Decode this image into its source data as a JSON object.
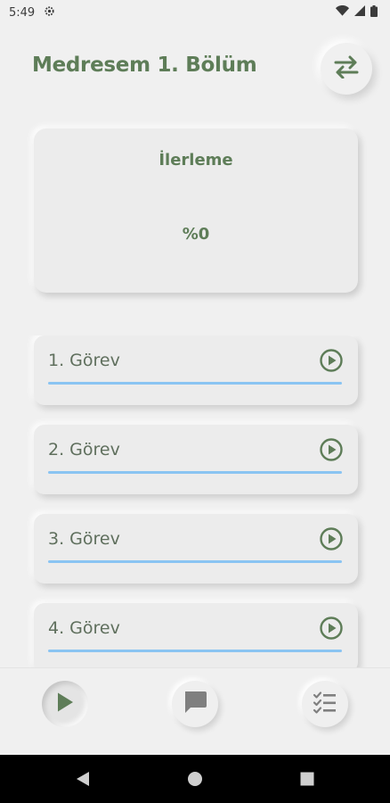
{
  "status_bar": {
    "time": "5:49"
  },
  "header": {
    "title": "Medresem 1. Bölüm"
  },
  "progress": {
    "title": "İlerleme",
    "value": "%0"
  },
  "tasks": [
    {
      "label": "1. Görev",
      "progress": 1.0
    },
    {
      "label": "2. Görev",
      "progress": 1.0
    },
    {
      "label": "3. Görev",
      "progress": 1.0
    },
    {
      "label": "4. Görev",
      "progress": 1.0
    }
  ],
  "bottom_nav": {
    "items": [
      {
        "icon": "play-icon",
        "active": true
      },
      {
        "icon": "chat-icon",
        "active": false
      },
      {
        "icon": "checklist-icon",
        "active": false
      }
    ]
  },
  "colors": {
    "accent": "#5e7d58",
    "progress_bar": "#8ac4f2",
    "background": "#f0f0f0"
  }
}
